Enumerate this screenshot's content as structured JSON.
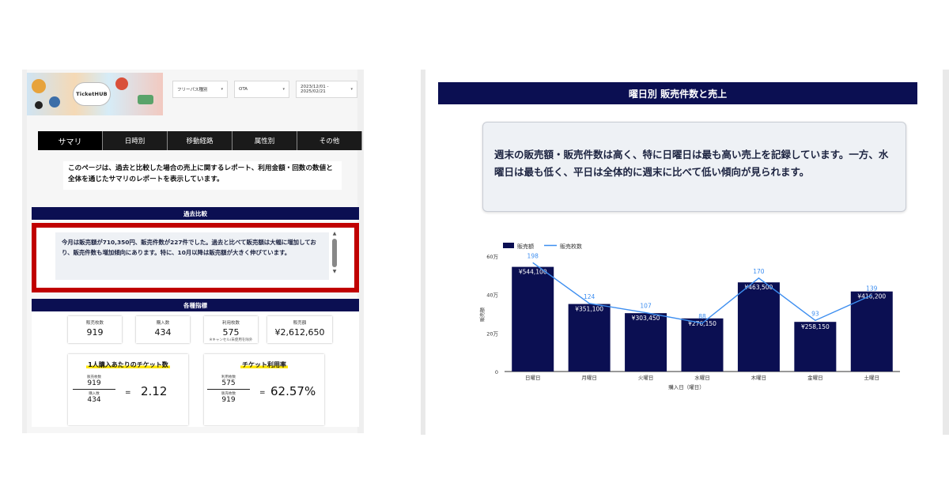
{
  "left": {
    "logo": {
      "text": "TicketHUB"
    },
    "filters": [
      {
        "label": "フリーパス種別"
      },
      {
        "label": "OTA"
      },
      {
        "label": "2023/12/01 - 2025/02/21"
      }
    ],
    "tabs": [
      "サマリ",
      "日時別",
      "移動経路",
      "属性別",
      "その他"
    ],
    "intro": "このページは、過去と比較した場合の売上に関するレポート、利用金額・回数の数値と全体を通じたサマリのレポートを表示しています。",
    "compare": {
      "heading": "過去比較",
      "text": "今月は販売額が710,350円、販売件数が227件でした。過去と比べて販売額は大幅に増加しており、販売件数も増加傾向にあります。特に、10月以降は販売額が大きく伸びています。"
    },
    "metrics": {
      "heading": "各種指標",
      "kpis": [
        {
          "label": "販売枚数",
          "value": "919",
          "note": ""
        },
        {
          "label": "購入数",
          "value": "434",
          "note": ""
        },
        {
          "label": "利用枚数",
          "value": "575",
          "note": "※キャンセル/未使用を除外"
        },
        {
          "label": "販売額",
          "value": "¥2,612,650",
          "note": ""
        }
      ],
      "per_person": {
        "title": "1人購入あたりのチケット数",
        "num_label": "販売枚数",
        "num": "919",
        "den_label": "購入数",
        "den": "434",
        "eq": "=",
        "result": "2.12"
      },
      "usage_rate": {
        "title": "チケット利用率",
        "num_label": "利用枚数",
        "num": "575",
        "den_label": "販売枚数",
        "den": "919",
        "eq": "=",
        "result": "62.57%"
      }
    }
  },
  "right": {
    "heading": "曜日別 販売件数と売上",
    "summary": "週末の販売額・販売件数は高く、特に日曜日は最も高い売上を記録しています。一方、水曜日は最も低く、平日は全体的に週末に比べて低い傾向が見られます。"
  },
  "chart_data": {
    "type": "bar",
    "title": "",
    "xlabel": "購入日（曜日）",
    "ylabel": "販売額",
    "categories": [
      "日曜日",
      "月曜日",
      "火曜日",
      "水曜日",
      "木曜日",
      "金曜日",
      "土曜日"
    ],
    "series": [
      {
        "name": "販売額",
        "kind": "bar",
        "values": [
          544100,
          351100,
          303450,
          276150,
          463500,
          258150,
          416200
        ],
        "labels": [
          "¥544,100",
          "¥351,100",
          "¥303,450",
          "¥276,150",
          "¥463,500",
          "¥258,150",
          "¥416,200"
        ],
        "color": "#0b0f52"
      },
      {
        "name": "販売枚数",
        "kind": "line",
        "values": [
          198,
          124,
          107,
          88,
          170,
          93,
          139
        ],
        "color": "#3d8ef0"
      }
    ],
    "yticks": [
      {
        "value": 0,
        "label": "0"
      },
      {
        "value": 200000,
        "label": "20万"
      },
      {
        "value": 400000,
        "label": "40万"
      },
      {
        "value": 600000,
        "label": "60万"
      }
    ],
    "ylim": [
      0,
      600000
    ],
    "y2lim": [
      0,
      210
    ],
    "legend": "top-left",
    "grid": false
  }
}
